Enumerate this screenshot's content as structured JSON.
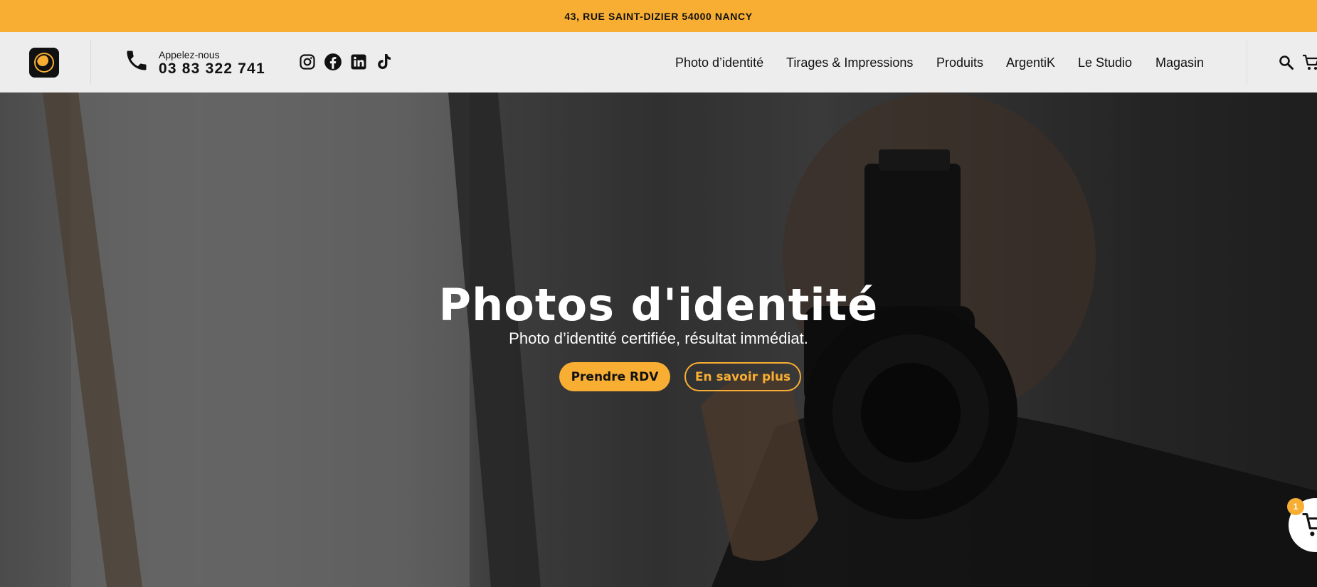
{
  "topbar": {
    "address": "43, RUE SAINT-DIZIER 54000 NANCY"
  },
  "header": {
    "logo_icon": "camera-eye-logo",
    "phone_icon": "phone-icon",
    "call_label": "Appelez-nous",
    "call_number": "03 83 322 741",
    "social": [
      "instagram-icon",
      "facebook-icon",
      "linkedin-icon",
      "tiktok-icon"
    ],
    "nav": [
      {
        "label": "Photo d’identité"
      },
      {
        "label": "Tirages & Impressions"
      },
      {
        "label": "Produits"
      },
      {
        "label": "ArgentiK"
      },
      {
        "label": "Le Studio"
      },
      {
        "label": "Magasin"
      }
    ],
    "search_icon": "search-icon",
    "cart_icon": "cart-icon"
  },
  "hero": {
    "title": "Photos d'identité",
    "subtitle": "Photo d’identité certifiée, résultat immédiat.",
    "primary_button": "Prendre RDV",
    "secondary_button": "En savoir plus"
  },
  "floating_cart": {
    "count": "1"
  },
  "colors": {
    "accent": "#f8ae33",
    "text_dark": "#111111",
    "header_bg": "#f4f4f4"
  }
}
